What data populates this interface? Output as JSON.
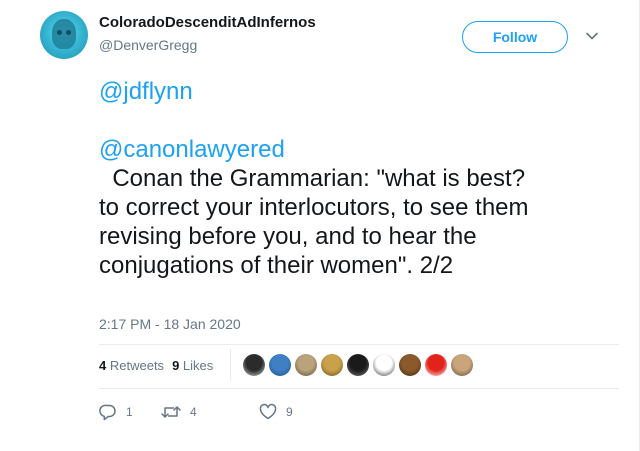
{
  "author": {
    "display_name": "ColoradoDescenditAdInfernos",
    "screen_name": "@DenverGregg"
  },
  "follow_label": "Follow",
  "tweet": {
    "lines": [
      {
        "text": "@jdflynn",
        "mention": true
      },
      {
        "text": "",
        "mention": false
      },
      {
        "text": "@canonlawyered",
        "mention": true
      },
      {
        "text": "  Conan the Grammarian: \"what is best?",
        "mention": false
      },
      {
        "text": "to correct your interlocutors, to see them",
        "mention": false
      },
      {
        "text": "revising before you, and to hear the",
        "mention": false
      },
      {
        "text": "conjugations of their women\". 2/2",
        "mention": false
      }
    ],
    "timestamp": "2:17 PM - 18 Jan 2020"
  },
  "stats": {
    "retweets_count": "4",
    "retweets_label": "Retweets",
    "likes_count": "9",
    "likes_label": "Likes"
  },
  "liker_avatars": [
    {
      "name": "liker-avatar-1",
      "colors": [
        "#2b2b2b",
        "#d9d9d9"
      ]
    },
    {
      "name": "liker-avatar-2",
      "colors": [
        "#3f7fc4",
        "#1f4f86"
      ]
    },
    {
      "name": "liker-avatar-3",
      "colors": [
        "#b9a27c",
        "#5b4a33"
      ]
    },
    {
      "name": "liker-avatar-4",
      "colors": [
        "#c9a14a",
        "#6b4a1c"
      ]
    },
    {
      "name": "liker-avatar-5",
      "colors": [
        "#1a1a1a",
        "#7a7a7a"
      ]
    },
    {
      "name": "liker-avatar-6",
      "colors": [
        "#ffffff",
        "#333333"
      ]
    },
    {
      "name": "liker-avatar-7",
      "colors": [
        "#8a5a2b",
        "#3a2410"
      ]
    },
    {
      "name": "liker-avatar-8",
      "colors": [
        "#e2231a",
        "#ffffff"
      ]
    },
    {
      "name": "liker-avatar-9",
      "colors": [
        "#caa57c",
        "#5a4a3a"
      ]
    }
  ],
  "actions": {
    "reply_count": "1",
    "retweet_count": "4",
    "like_count": "9"
  },
  "colors": {
    "accent": "#1da1f2",
    "secondary_text": "#657786",
    "primary_text": "#14171a",
    "divider": "#e6ecf0"
  }
}
